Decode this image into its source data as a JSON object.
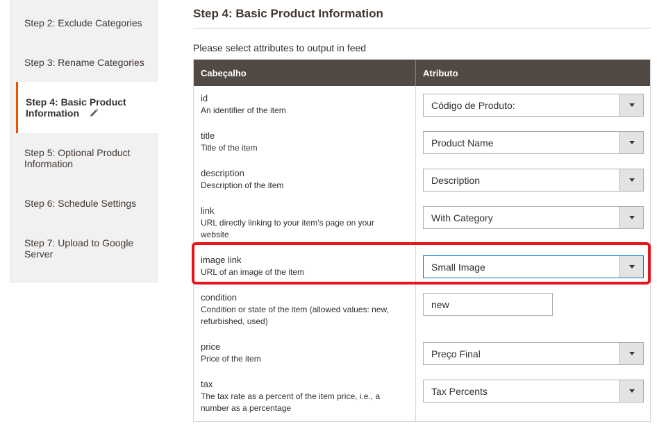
{
  "sidebar": {
    "items": [
      {
        "label": "Step 2: Exclude Categories"
      },
      {
        "label": "Step 3: Rename Categories"
      },
      {
        "label": "Step 4: Basic Product Information"
      },
      {
        "label": "Step 5: Optional Product Information"
      },
      {
        "label": "Step 6: Schedule Settings"
      },
      {
        "label": "Step 7: Upload to Google Server"
      }
    ],
    "active_index": 2
  },
  "main": {
    "title": "Step 4: Basic Product Information",
    "intro": "Please select attributes to output in feed",
    "table": {
      "headers": {
        "header": "Cabeçalho",
        "attribute": "Atributo"
      },
      "rows": [
        {
          "name": "id",
          "description": "An identifier of the item",
          "control": "select",
          "value": "Código de Produto:"
        },
        {
          "name": "title",
          "description": "Title of the item",
          "control": "select",
          "value": "Product Name"
        },
        {
          "name": "description",
          "description": "Description of the item",
          "control": "select",
          "value": "Description"
        },
        {
          "name": "link",
          "description": "URL directly linking to your item's page on your website",
          "control": "select",
          "value": "With Category"
        },
        {
          "name": "image link",
          "description": "URL of an image of the item",
          "control": "select",
          "value": "Small Image"
        },
        {
          "name": "condition",
          "description": "Condition or state of the item (allowed values: new, refurbished, used)",
          "control": "input",
          "value": "new"
        },
        {
          "name": "price",
          "description": "Price of the item",
          "control": "select",
          "value": "Preço Final"
        },
        {
          "name": "tax",
          "description": "The tax rate as a percent of the item price, i.e., a number as a percentage",
          "control": "select",
          "value": "Tax Percents"
        }
      ]
    }
  },
  "colors": {
    "accent": "#eb5202",
    "header_bg": "#514943",
    "highlight": "#e8141c",
    "focus": "#007bdb"
  },
  "icons": {
    "edit": "pencil-icon",
    "dropdown": "chevron-down-icon"
  }
}
